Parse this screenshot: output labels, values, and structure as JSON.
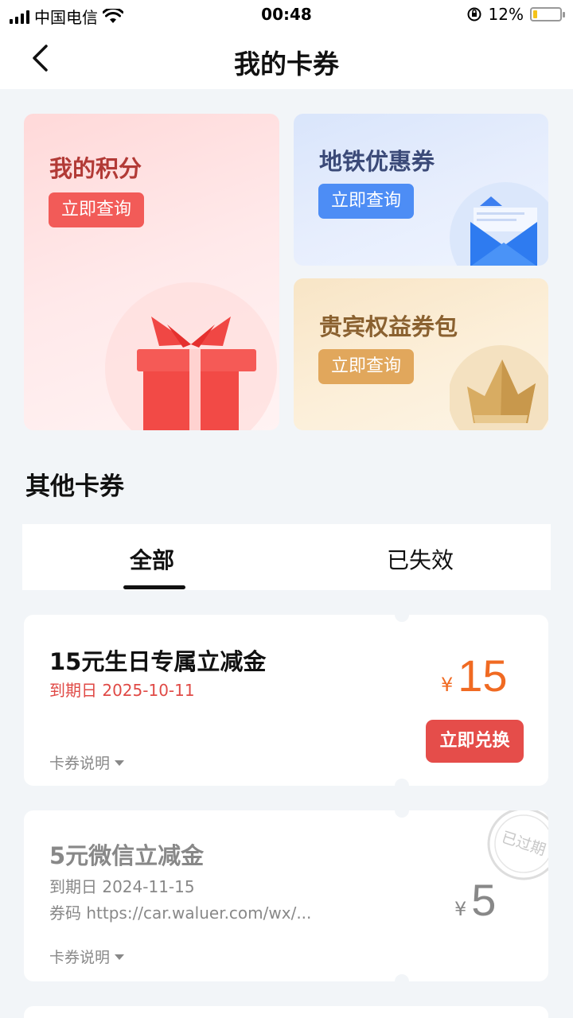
{
  "status_bar": {
    "carrier": "中国电信",
    "time": "00:48",
    "battery": "12%"
  },
  "nav": {
    "title": "我的卡券"
  },
  "cards": {
    "points": {
      "title": "我的积分",
      "button": "立即查询"
    },
    "subway": {
      "title": "地铁优惠券",
      "button": "立即查询"
    },
    "vip": {
      "title": "贵宾权益券包",
      "button": "立即查询"
    }
  },
  "section": {
    "title": "其他卡券"
  },
  "tabs": [
    {
      "label": "全部",
      "active": true
    },
    {
      "label": "已失效",
      "active": false
    }
  ],
  "coupons": [
    {
      "title": "15元生日专属立减金",
      "expiry": "到期日 2025-10-11",
      "currency": "¥",
      "amount": "15",
      "action": "立即兑换",
      "desc": "卡券说明"
    },
    {
      "title": "5元微信立减金",
      "expiry": "到期日 2024-11-15",
      "code": "券码  https://car.waluer.com/wx/...",
      "currency": "¥",
      "amount": "5",
      "stamp": "已过期",
      "desc": "卡券说明"
    }
  ],
  "colors": {
    "accent_red": "#e54d4a",
    "amount_orange": "#f06a22",
    "subway_blue": "#4d8df5",
    "vip_gold": "#e1a75c"
  },
  "icons": {
    "back": "chevron-left-icon",
    "gift": "gift-icon",
    "envelope": "envelope-icon",
    "crown": "crown-icon"
  }
}
